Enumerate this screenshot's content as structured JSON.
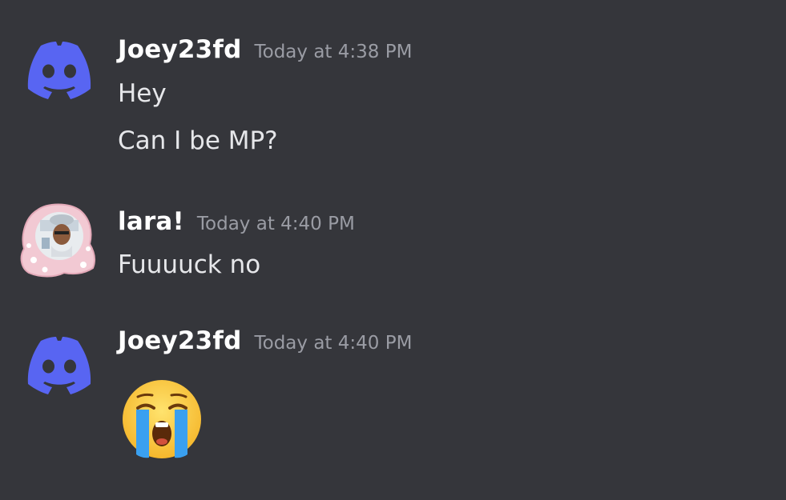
{
  "colors": {
    "background": "#35363b",
    "discord_blurple": "#5865f2",
    "username": "#ffffff",
    "timestamp": "#9a9ca4",
    "message_text": "#e6e7ea"
  },
  "messages": [
    {
      "author": "Joey23fd",
      "avatar_icon": "discord-logo-icon",
      "timestamp": "Today at 4:38 PM",
      "lines": [
        "Hey",
        "Can I be MP?"
      ]
    },
    {
      "author": "lara!",
      "avatar_icon": "custom-avatar-image",
      "timestamp": "Today at 4:40 PM",
      "lines": [
        "Fuuuuck no"
      ]
    },
    {
      "author": "Joey23fd",
      "avatar_icon": "discord-logo-icon",
      "timestamp": "Today at 4:40 PM",
      "emoji": "loudly-crying-face-emoji"
    }
  ]
}
